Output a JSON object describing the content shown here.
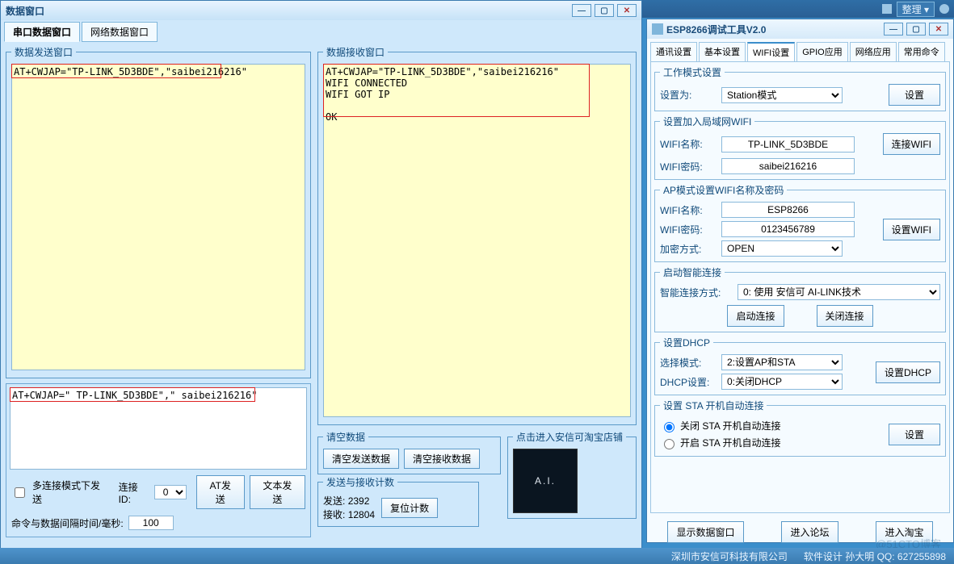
{
  "shell": {
    "arrange": "整理 ▾"
  },
  "left_window": {
    "title": "数据窗口",
    "tabs": {
      "serial": "串口数据窗口",
      "net": "网络数据窗口"
    },
    "send_group": "数据发送窗口",
    "send_text": "AT+CWJAP=\"TP-LINK_5D3BDE\",\"saibei216216\"",
    "send_text2": "AT+CWJAP=\" TP-LINK_5D3BDE\",\" saibei216216\"",
    "recv_group": "数据接收窗口",
    "recv_text": "AT+CWJAP=\"TP-LINK_5D3BDE\",\"saibei216216\"\nWIFI CONNECTED\nWIFI GOT IP\n\nOK",
    "clear_group": "请空数据",
    "clear_send": "清空发送数据",
    "clear_recv": "清空接收数据",
    "stats_group": "发送与接收计数",
    "tx_label": "发送:",
    "tx": "2392",
    "rx_label": "接收:",
    "rx": "12804",
    "reset_count": "复位计数",
    "taobao_group": "点击进入安信可淘宝店铺",
    "ai_text": "A.I.",
    "multilink": "多连接模式下发送",
    "conn_id_label": "连接ID:",
    "conn_id": "0",
    "at_send": "AT发送",
    "text_send": "文本发送",
    "interval_label": "命令与数据间隔时间/毫秒:",
    "interval": "100"
  },
  "right_window": {
    "title": "ESP8266调试工具V2.0",
    "tabs": [
      "通讯设置",
      "基本设置",
      "WIFI设置",
      "GPIO应用",
      "网络应用",
      "常用命令"
    ],
    "workmode_group": "工作模式设置",
    "set_as": "设置为:",
    "station_mode": "Station模式",
    "set": "设置",
    "join_lan_group": "设置加入局域网WIFI",
    "wifi_name_label": "WIFI名称:",
    "wifi_name": "TP-LINK_5D3BDE",
    "wifi_pwd_label": "WIFI密码:",
    "wifi_pwd": "saibei216216",
    "connect_wifi": "连接WIFI",
    "ap_group": "AP模式设置WIFI名称及密码",
    "ap_name": "ESP8266",
    "ap_pwd": "0123456789",
    "enc_label": "加密方式:",
    "enc": "OPEN",
    "set_wifi": "设置WIFI",
    "smart_group": "启动智能连接",
    "smart_label": "智能连接方式:",
    "smart_mode": "0: 使用 安信可 AI-LINK技术",
    "start_conn": "启动连接",
    "close_conn": "关闭连接",
    "dhcp_group": "设置DHCP",
    "select_mode_label": "选择模式:",
    "select_mode": "2:设置AP和STA",
    "dhcp_set_label": "DHCP设置:",
    "dhcp_set": "0:关闭DHCP",
    "set_dhcp": "设置DHCP",
    "sta_group": "设置 STA 开机自动连接",
    "sta_off": "关闭 STA 开机自动连接",
    "sta_on": "开启 STA 开机自动连接",
    "show_data": "显示数据窗口",
    "forum": "进入论坛",
    "enter_taobao": "进入淘宝"
  },
  "footer": {
    "company": "深圳市安信可科技有限公司",
    "designer": "软件设计 孙大明 QQ: 627255898"
  },
  "watermark": "@51CTO博客"
}
